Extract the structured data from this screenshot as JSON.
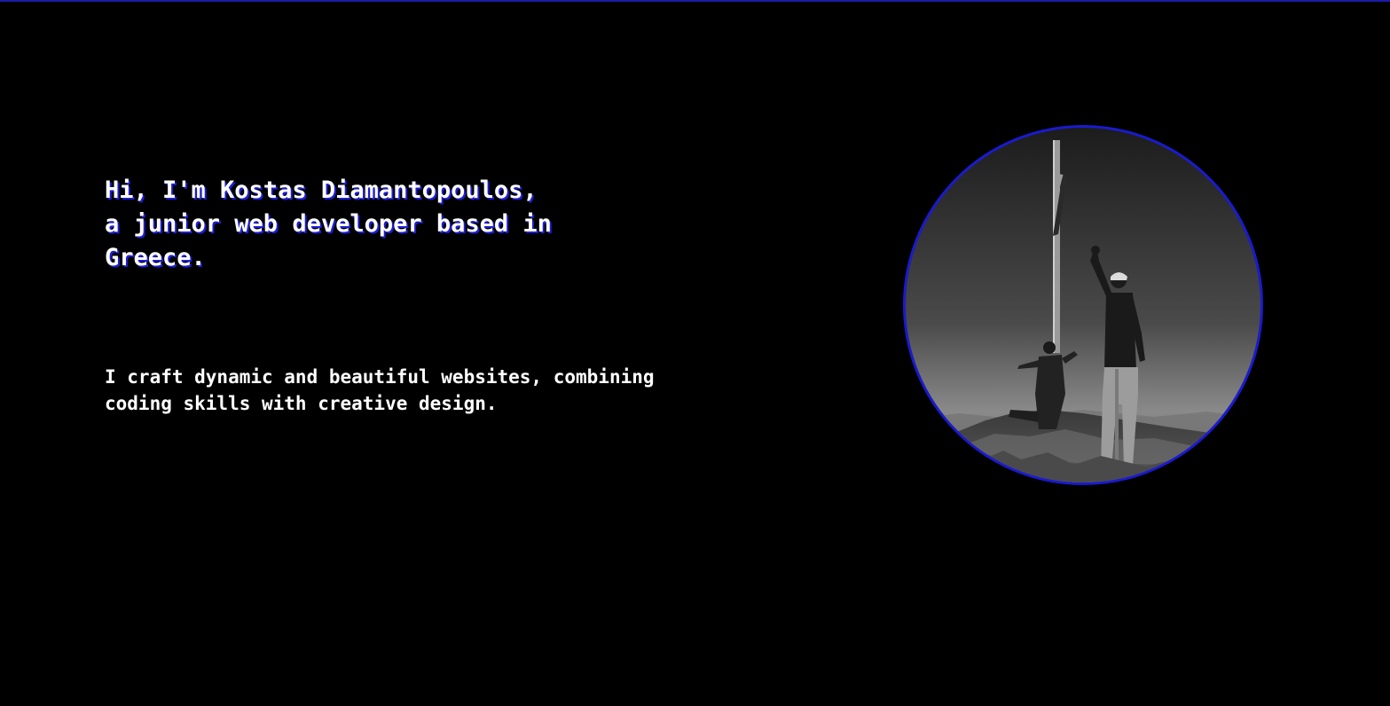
{
  "hero": {
    "headline": "Hi, I'm Kostas Diamantopoulos, a junior web developer based in Greece.",
    "subtitle": "I craft dynamic and beautiful websites, combining coding skills with creative design."
  },
  "colors": {
    "background": "#000000",
    "accent": "#1a1ad0",
    "text": "#ffffff"
  },
  "profile_photo": {
    "icon": "profile-photo"
  }
}
